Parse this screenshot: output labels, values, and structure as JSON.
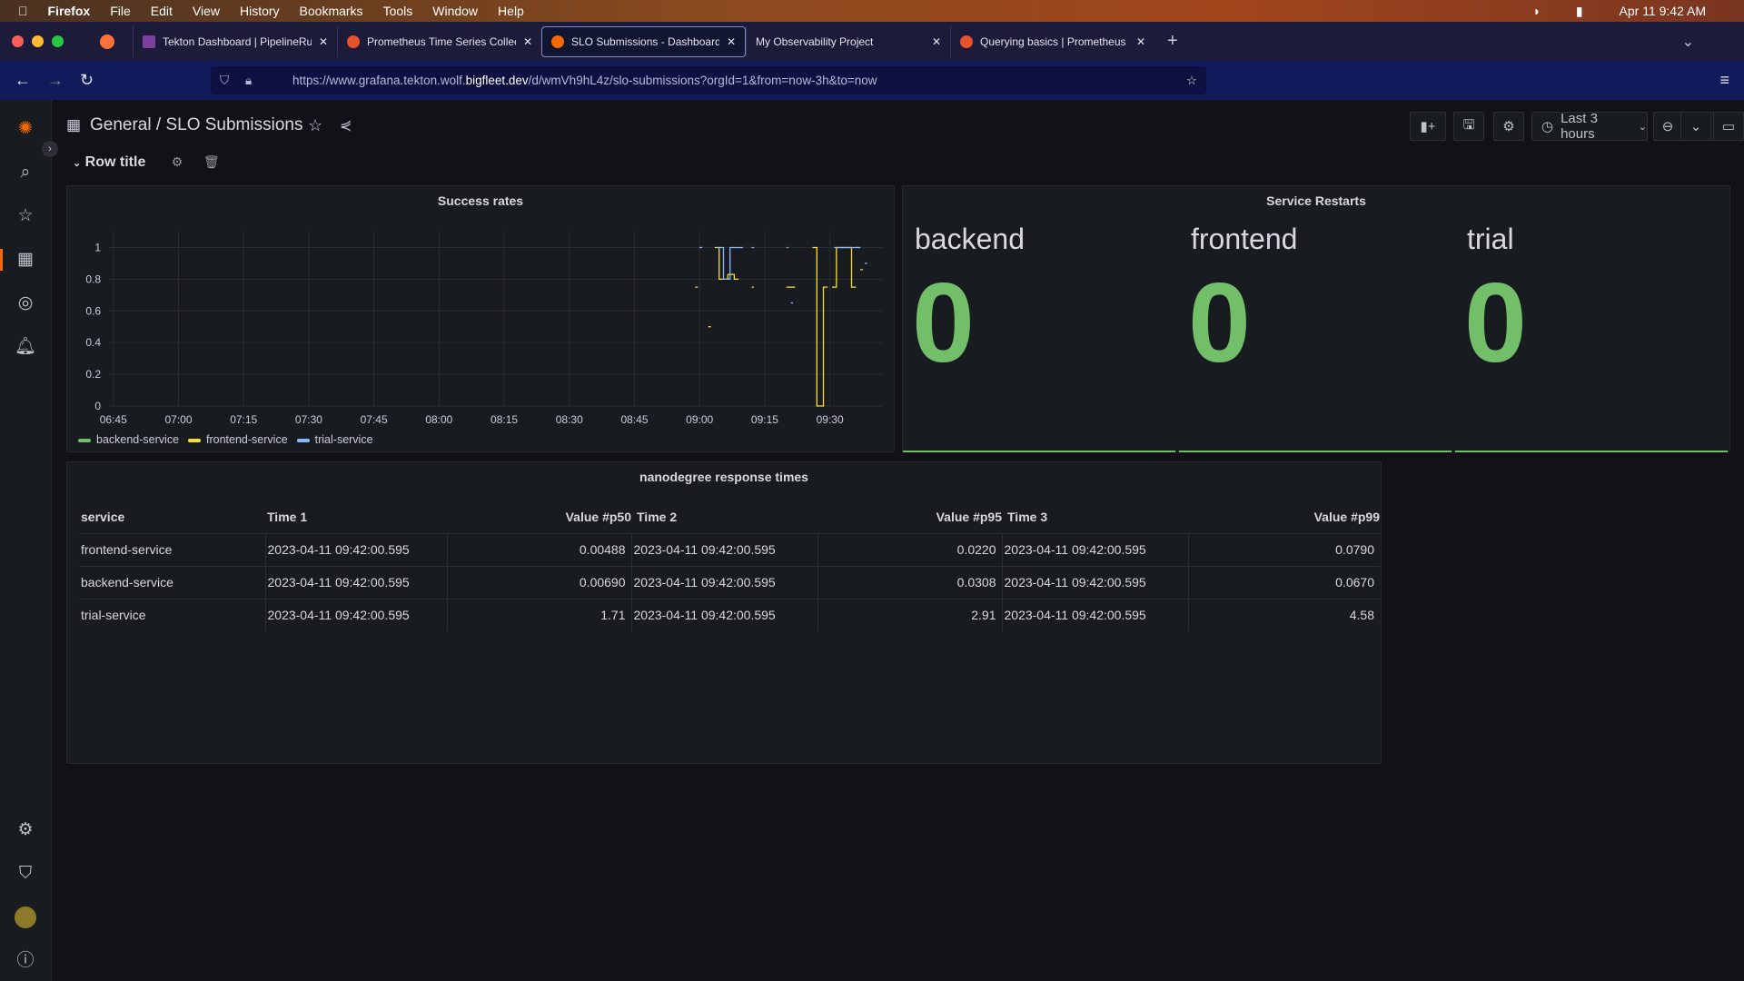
{
  "menubar": {
    "app": "Firefox",
    "items": [
      "File",
      "Edit",
      "View",
      "History",
      "Bookmarks",
      "Tools",
      "Window",
      "Help"
    ],
    "clock": "Apr 11  9:42 AM"
  },
  "tabs": [
    {
      "label": "Tekton Dashboard | PipelineRuns"
    },
    {
      "label": "Prometheus Time Series Collection"
    },
    {
      "label": "SLO Submissions - Dashboards"
    },
    {
      "label": "My Observability Project"
    },
    {
      "label": "Querying basics | Prometheus"
    }
  ],
  "url": {
    "prefix": "https://www.grafana.tekton.wolf.",
    "host": "bigfleet.dev",
    "path": "/d/wmVh9hL4z/slo-submissions?orgId=1&from=now-3h&to=now"
  },
  "breadcrumb": {
    "folder": "General",
    "sep": "/",
    "dashboard": "SLO Submissions"
  },
  "toolbar": {
    "time_range": "Last 3 hours"
  },
  "row": {
    "title": "Row title"
  },
  "colors": {
    "backend": "#73bf69",
    "frontend": "#fade2a",
    "trial": "#8ab8ff"
  },
  "chart_data": {
    "type": "line",
    "title": "Success rates",
    "ylim": [
      0,
      1.1
    ],
    "yticks": [
      "0",
      "0.2",
      "0.4",
      "0.6",
      "0.8",
      "1"
    ],
    "xticks": [
      "06:45",
      "07:00",
      "07:15",
      "07:30",
      "07:45",
      "08:00",
      "08:15",
      "08:30",
      "08:45",
      "09:00",
      "09:15",
      "09:30"
    ],
    "x_range_minutes": [
      -1,
      177
    ],
    "series": [
      {
        "name": "backend-service",
        "color": "#73bf69",
        "points": [
          [
            155,
            1
          ],
          [
            155.5,
            1
          ],
          null,
          [
            171,
            1
          ],
          [
            172,
            1
          ]
        ]
      },
      {
        "name": "frontend-service",
        "color": "#fade2a",
        "points": [
          [
            134,
            0.75
          ],
          [
            134.6,
            0.75
          ],
          null,
          [
            137,
            0.5
          ],
          [
            137.6,
            0.5
          ],
          null,
          [
            138.5,
            1
          ],
          [
            139.5,
            1
          ],
          [
            139.5,
            0.8
          ],
          [
            141.5,
            0.8
          ],
          [
            141.5,
            0.83
          ],
          [
            143,
            0.83
          ],
          [
            143,
            0.8
          ],
          [
            144,
            0.8
          ],
          null,
          [
            147,
            0.75
          ],
          [
            147.5,
            0.75
          ],
          null,
          [
            155,
            0.75
          ],
          [
            157,
            0.75
          ],
          null,
          [
            161,
            1
          ],
          [
            162,
            1
          ],
          [
            162,
            0
          ],
          [
            163.5,
            0
          ],
          [
            163.5,
            0.75
          ],
          [
            164.5,
            0.75
          ],
          null,
          [
            165.5,
            0.75
          ],
          [
            166.5,
            0.75
          ],
          [
            166.5,
            1
          ],
          [
            170,
            1
          ],
          [
            170,
            0.75
          ],
          [
            171,
            0.75
          ],
          null,
          [
            172,
            0.86
          ],
          [
            172.6,
            0.86
          ]
        ]
      },
      {
        "name": "trial-service",
        "color": "#8ab8ff",
        "points": [
          [
            135,
            1
          ],
          [
            135.6,
            1
          ],
          null,
          [
            139,
            1
          ],
          [
            140.5,
            1
          ],
          [
            140.5,
            0.8
          ],
          [
            142,
            0.8
          ],
          [
            142,
            1
          ],
          [
            145,
            1
          ],
          null,
          [
            147,
            1
          ],
          [
            147.5,
            1
          ],
          null,
          [
            156,
            0.65
          ],
          [
            156.5,
            0.65
          ],
          null,
          [
            166,
            1
          ],
          [
            172,
            1
          ],
          null,
          [
            173,
            0.9
          ],
          [
            173.6,
            0.9
          ]
        ]
      }
    ]
  },
  "stats": {
    "title": "Service Restarts",
    "items": [
      {
        "name": "backend",
        "value": "0"
      },
      {
        "name": "frontend",
        "value": "0"
      },
      {
        "name": "trial",
        "value": "0"
      }
    ]
  },
  "table": {
    "title": "nanodegree response times",
    "headers": [
      "service",
      "Time 1",
      "Value #p50",
      "Time 2",
      "Value #p95",
      "Time 3",
      "Value #p99"
    ],
    "rows": [
      [
        "frontend-service",
        "2023-04-11 09:42:00.595",
        "0.00488",
        "2023-04-11 09:42:00.595",
        "0.0220",
        "2023-04-11 09:42:00.595",
        "0.0790"
      ],
      [
        "backend-service",
        "2023-04-11 09:42:00.595",
        "0.00690",
        "2023-04-11 09:42:00.595",
        "0.0308",
        "2023-04-11 09:42:00.595",
        "0.0670"
      ],
      [
        "trial-service",
        "2023-04-11 09:42:00.595",
        "1.71",
        "2023-04-11 09:42:00.595",
        "2.91",
        "2023-04-11 09:42:00.595",
        "4.58"
      ]
    ]
  }
}
